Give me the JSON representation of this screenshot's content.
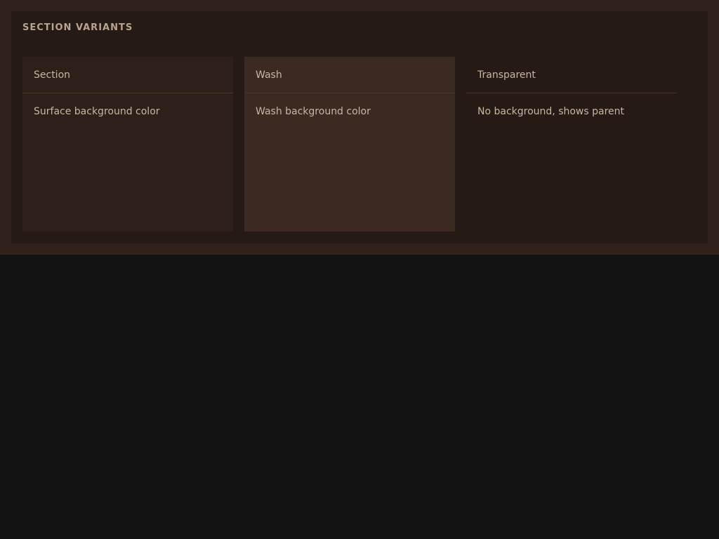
{
  "panel": {
    "title": "SECTION VARIANTS"
  },
  "cards": [
    {
      "header": "Section",
      "body": "Surface background color"
    },
    {
      "header": "Wash",
      "body": "Wash background color"
    },
    {
      "header": "Transparent",
      "body": "No background, shows parent"
    }
  ],
  "colors": {
    "page_background": "#131313",
    "outer_background": "#30221b",
    "panel_background": "#251a14",
    "section_surface": "#2e2019",
    "wash_surface": "#3b2a21",
    "text": "#c7b6a5"
  }
}
